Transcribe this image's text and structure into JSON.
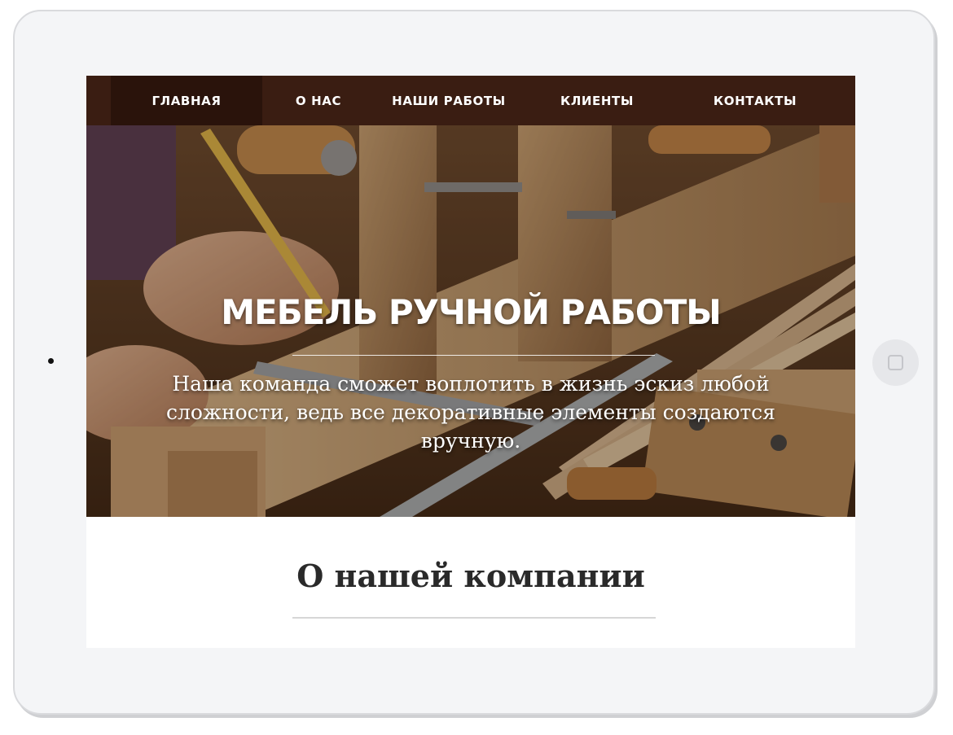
{
  "nav": {
    "items": [
      {
        "label": "ГЛАВНАЯ",
        "active": true
      },
      {
        "label": "О НАС",
        "active": false
      },
      {
        "label": "НАШИ РАБОТЫ",
        "active": false
      },
      {
        "label": "КЛИЕНТЫ",
        "active": false
      },
      {
        "label": "КОНТАКТЫ",
        "active": false
      }
    ]
  },
  "hero": {
    "title": "МЕБЕЛЬ РУЧНОЙ РАБОТЫ",
    "text": "Наша команда сможет воплотить в жизнь эскиз любой сложности, ведь все декоративные элементы создаются вручную.",
    "image": "woodworking-hands-measuring-photo"
  },
  "about": {
    "title": "О нашей компании"
  },
  "colors": {
    "nav_bg": "#3a1d12",
    "nav_active_bg": "#2a130b",
    "device_frame": "#f4f5f7",
    "text_dark": "#2a2a2a"
  },
  "icons": {
    "home_button": "square-home-icon",
    "bullet": "bullet-dot"
  }
}
